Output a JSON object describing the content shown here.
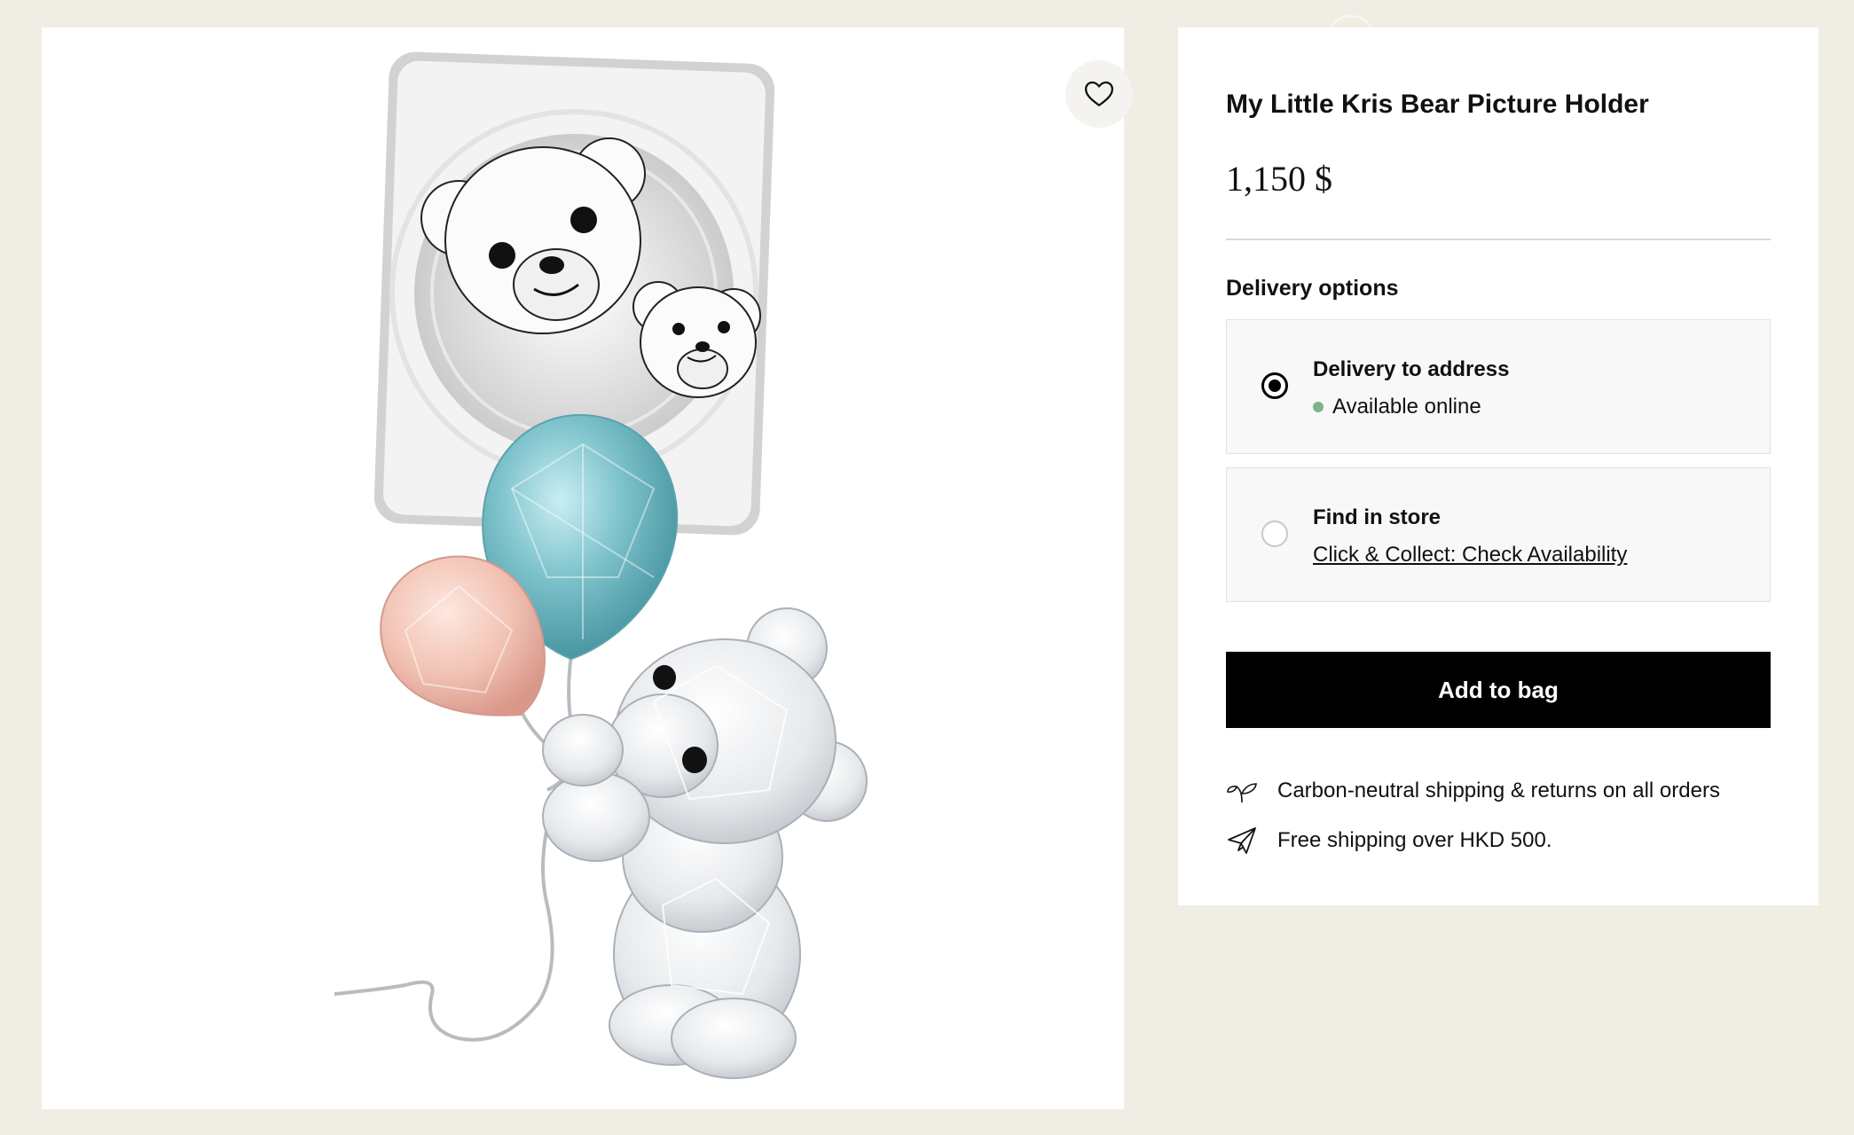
{
  "product": {
    "title": "My Little Kris Bear Picture Holder",
    "price": "1,150 $"
  },
  "gallery": {
    "image_alt": "crystal bear figurine holding a blue and a pink balloon with a picture card",
    "wishlist_icon": "heart-icon"
  },
  "delivery": {
    "heading": "Delivery options",
    "options": [
      {
        "title": "Delivery to address",
        "subtitle": "Available online",
        "selected": true,
        "status_color": "#7fb486"
      },
      {
        "title": "Find in store",
        "subtitle": "Click & Collect: Check Availability",
        "selected": false
      }
    ]
  },
  "actions": {
    "add_to_bag": "Add to bag"
  },
  "info": [
    {
      "icon": "leaf-icon",
      "text": "Carbon-neutral shipping & returns on all orders"
    },
    {
      "icon": "paper-plane-icon",
      "text": "Free shipping over HKD 500."
    }
  ],
  "colors": {
    "page_background": "#f0ede5",
    "button_background": "#000000",
    "button_text": "#ffffff"
  }
}
